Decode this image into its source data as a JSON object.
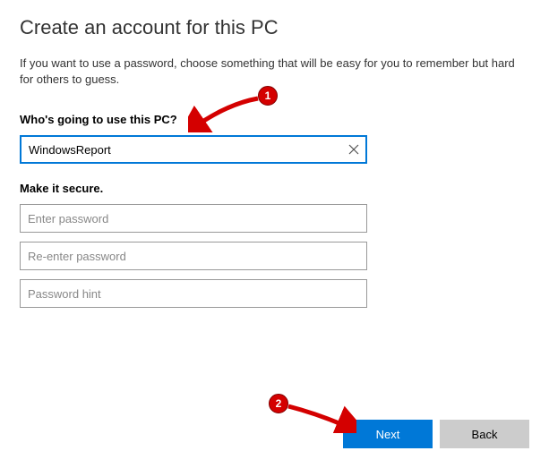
{
  "title": "Create an account for this PC",
  "subtitle": "If you want to use a password, choose something that will be easy for you to remember but hard for others to guess.",
  "section1": {
    "label": "Who's going to use this PC?",
    "username_value": "WindowsReport"
  },
  "section2": {
    "label": "Make it secure.",
    "password_placeholder": "Enter password",
    "reenter_placeholder": "Re-enter password",
    "hint_placeholder": "Password hint"
  },
  "buttons": {
    "next": "Next",
    "back": "Back"
  },
  "annotations": {
    "badge1": "1",
    "badge2": "2"
  }
}
